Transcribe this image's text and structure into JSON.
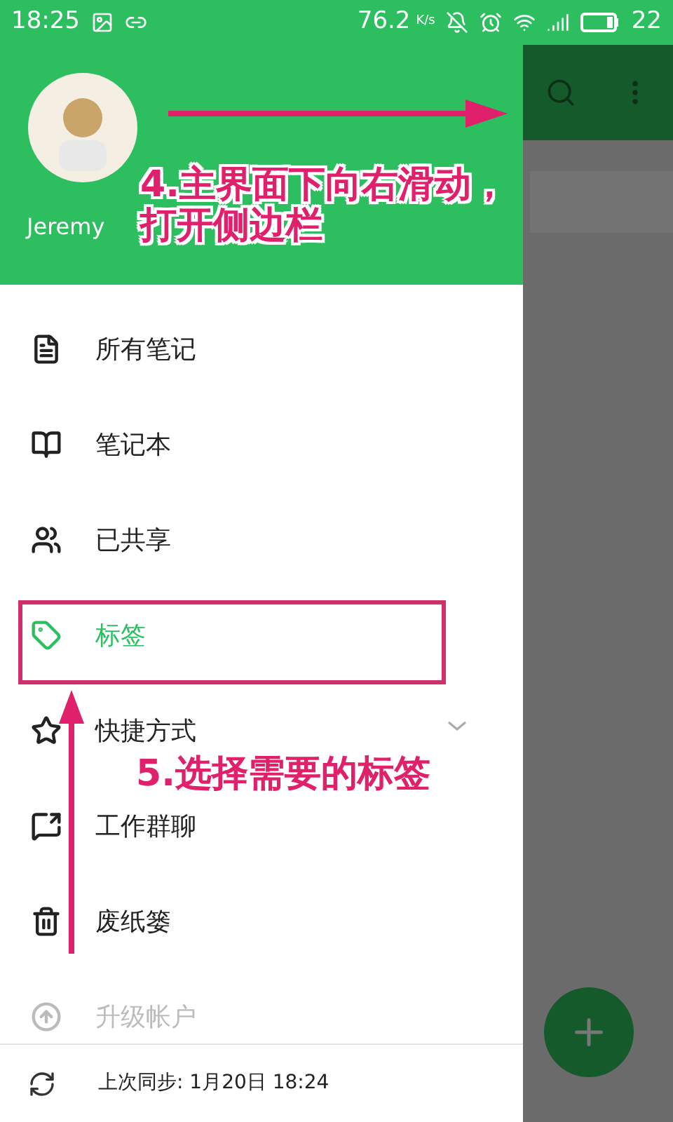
{
  "status_bar": {
    "time": "18:25",
    "speed": "76.2",
    "speed_unit": "K/s",
    "battery": "22"
  },
  "drawer": {
    "user": {
      "name": "Jeremy"
    },
    "items": [
      {
        "label": "所有笔记",
        "kind": "nav",
        "selected": false,
        "disabled": false
      },
      {
        "label": "笔记本",
        "kind": "nav",
        "selected": false,
        "disabled": false
      },
      {
        "label": "已共享",
        "kind": "nav",
        "selected": false,
        "disabled": false
      },
      {
        "label": "标签",
        "kind": "nav",
        "selected": true,
        "disabled": false
      },
      {
        "label": "快捷方式",
        "kind": "expandable",
        "selected": false,
        "disabled": false
      },
      {
        "label": "工作群聊",
        "kind": "nav",
        "selected": false,
        "disabled": false
      },
      {
        "label": "废纸篓",
        "kind": "nav",
        "selected": false,
        "disabled": false
      },
      {
        "label": "升级帐户",
        "kind": "nav",
        "selected": false,
        "disabled": true
      }
    ],
    "sync": "上次同步: 1月20日 18:24"
  },
  "annotations": [
    {
      "number": "4.",
      "lines": [
        "主界面下向右滑动，",
        "打开侧边栏"
      ]
    },
    {
      "number": "5.",
      "lines": [
        "选择需要的标签"
      ]
    }
  ]
}
